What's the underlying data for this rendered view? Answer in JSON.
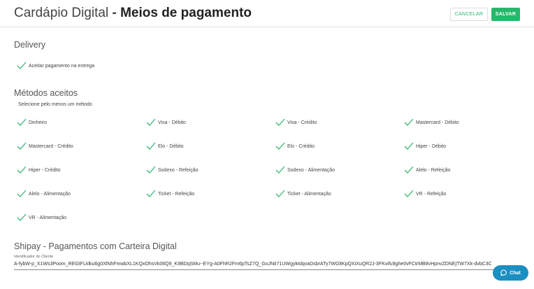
{
  "header": {
    "app_name": "Cardápio Digital",
    "separator": " - ",
    "page_title": "Meios de pagamento",
    "cancel_label": "CANCELAR",
    "save_label": "SALVAR"
  },
  "delivery": {
    "title": "Delivery",
    "option": "Aceitar pagamento na entrega"
  },
  "metodos": {
    "title": "Métodos aceitos",
    "subtitle": "Selecione pelo menos um método",
    "items": [
      "Dinheiro",
      "Visa - Débito",
      "Visa - Crédito",
      "Mastercard - Débito",
      "Mastercard - Crédito",
      "Elo - Débito",
      "Elo - Crédito",
      "Hiper - Débito",
      "Hiper - Crédito",
      "Sodexo - Refeição",
      "Sodexo - Alimentação",
      "Alelo - Refeição",
      "Alelo - Alimentação",
      "Ticket - Refeição",
      "Ticket - Alimentação",
      "VR - Refeição",
      "VR - Alimentação"
    ]
  },
  "shipay": {
    "title": "Shipay - Pagamentos com Carteira Digital",
    "field_label": "Identificador do Cliente",
    "field_value": "A-fybW-p_X1Ws3Poom_REGtFLklku6g0XlNhFmwbXL1KQxOhsVk06Q9_K9BDqSMu--EYg-A0FhR2Fm6pTsZ7Q_GoJNiI71UWgyktdqvaDsbrATy7WGltKpQXiXuQR2J-3FKvifu9ghe0vFCtrMB8vHpnvZDNEjTW7Xk-dvbC3C"
  },
  "chat": {
    "label": "Chat"
  },
  "colors": {
    "accent": "#27b76a",
    "check": "#3cb878",
    "chat": "#1a8fc1"
  }
}
